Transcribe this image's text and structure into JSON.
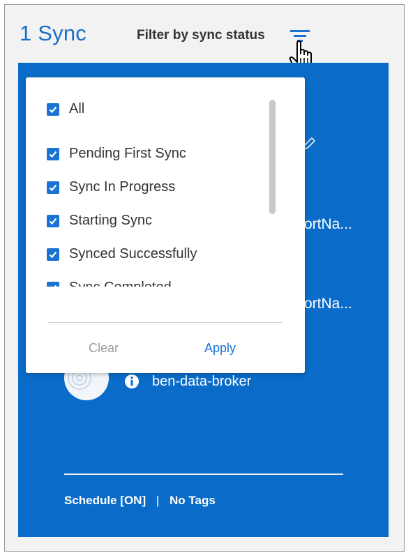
{
  "header": {
    "count_title": "1 Sync",
    "filter_label": "Filter by sync status"
  },
  "card": {
    "port_text_1": "ortNa...",
    "port_text_2": "ortNa...",
    "broker_name": "ben-data-broker",
    "footer_schedule": "Schedule [ON]",
    "footer_separator": "|",
    "footer_tags": "No Tags"
  },
  "filter_dropdown": {
    "options": [
      {
        "label": "All",
        "checked": true
      },
      {
        "label": "Pending First Sync",
        "checked": true
      },
      {
        "label": "Sync In Progress",
        "checked": true
      },
      {
        "label": "Starting Sync",
        "checked": true
      },
      {
        "label": "Synced Successfully",
        "checked": true
      },
      {
        "label": "Sync Completed",
        "checked": true
      }
    ],
    "clear_label": "Clear",
    "apply_label": "Apply"
  },
  "colors": {
    "accent": "#1a6fc6",
    "card_background": "#0a6cc8",
    "checkbox": "#1a73d4",
    "clear_text": "#9a9a9a"
  },
  "icons": [
    "filter-icon",
    "hand-pointer-icon",
    "pencil-icon",
    "info-icon",
    "check-icon"
  ]
}
